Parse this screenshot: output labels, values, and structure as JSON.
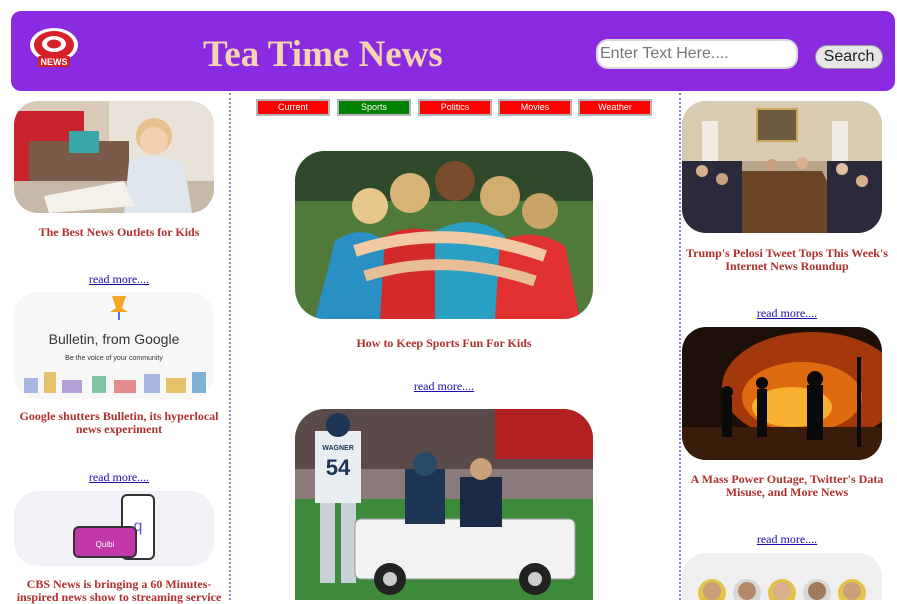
{
  "header": {
    "logo_text": "NEWS",
    "site_title": "Tea Time News",
    "search_placeholder": "Enter Text Here....",
    "search_button": "Search"
  },
  "nav": {
    "tabs": [
      {
        "label": "Current",
        "color": "#ff0000"
      },
      {
        "label": "Sports",
        "color": "#008000"
      },
      {
        "label": "Politics",
        "color": "#ff0000"
      },
      {
        "label": "Movies",
        "color": "#ff0000"
      },
      {
        "label": "Weather",
        "color": "#ff0000"
      }
    ]
  },
  "left_column": {
    "articles": [
      {
        "title": "The Best News Outlets for Kids",
        "link": "read more...."
      },
      {
        "title": "Google shutters Bulletin, its hyperlocal news experiment",
        "link": "read more....",
        "image_heading": "Bulletin, from Google",
        "image_caption": "Be the voice of your community"
      },
      {
        "title": "CBS News is bringing a 60 Minutes-inspired news show to streaming service",
        "image_label": "Quibi"
      }
    ]
  },
  "center_column": {
    "articles": [
      {
        "title": "How to Keep Sports Fun For Kids",
        "link": "read more...."
      },
      {
        "image_name": "WAGNER",
        "image_number": "54"
      }
    ]
  },
  "right_column": {
    "articles": [
      {
        "title": "Trump's Pelosi Tweet Tops This Week's Internet News Roundup",
        "link": "read more...."
      },
      {
        "title": "A Mass Power Outage, Twitter's Data Misuse, and More News",
        "link": "read more...."
      },
      {}
    ]
  },
  "colors": {
    "header_bg": "#8a2be2",
    "title_color": "#f5d5b0",
    "headline_color": "#b03030",
    "link_color": "#1a0dab"
  }
}
